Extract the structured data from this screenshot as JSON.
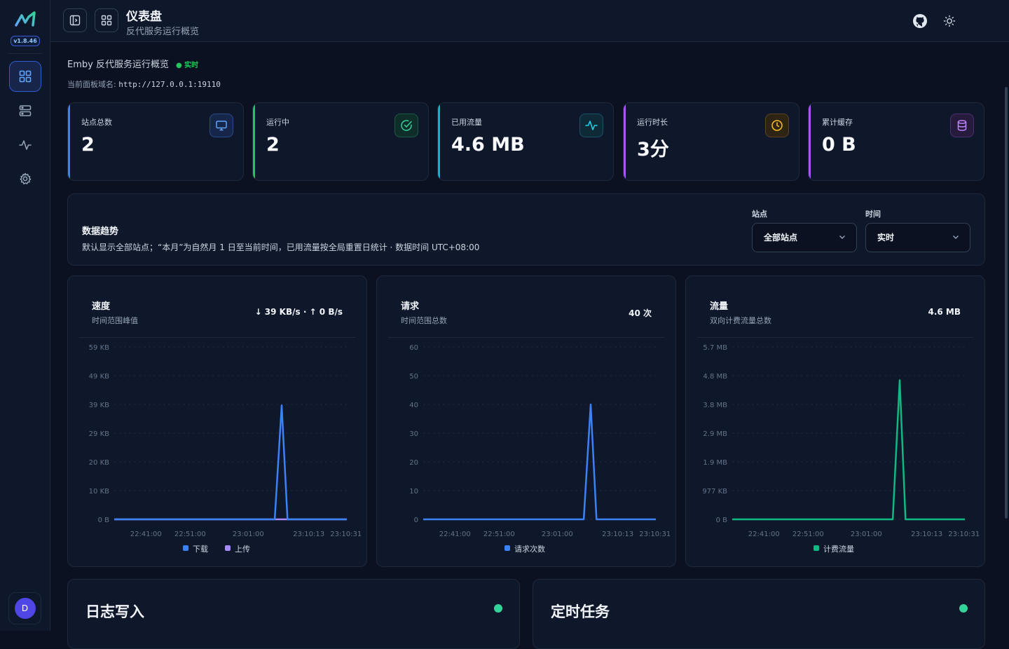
{
  "app": {
    "version": "v1.8.46",
    "user_initial": "D"
  },
  "header": {
    "title": "仪表盘",
    "subtitle": "反代服务运行概览"
  },
  "overview": {
    "text": "Emby 反代服务运行概览",
    "live": "● 实时",
    "domain_label": "当前面板域名:",
    "domain_value": "http://127.0.0.1:19110"
  },
  "stats": [
    {
      "label": "站点总数",
      "value": "2",
      "color": "#3b82f6",
      "icon": "monitor-icon"
    },
    {
      "label": "运行中",
      "value": "2",
      "color": "#22c55e",
      "icon": "check-circle-icon"
    },
    {
      "label": "已用流量",
      "value": "4.6 MB",
      "color": "#06b6d4",
      "icon": "activity-icon"
    },
    {
      "label": "运行时长",
      "value": "3分",
      "color": "#a855f7",
      "icon": "clock-icon"
    },
    {
      "label": "累计缓存",
      "value": "0 B",
      "color": "#a855f7",
      "icon": "database-icon"
    }
  ],
  "trend": {
    "title": "数据趋势",
    "desc": "默认显示全部站点；“本月”为自然月 1 日至当前时间，已用流量按全局重置日统计 · 数据时间 UTC+08:00",
    "site_label": "站点",
    "site_value": "全部站点",
    "time_label": "时间",
    "time_value": "实时"
  },
  "chart_data": [
    {
      "type": "line",
      "title": "速度",
      "subtitle": "时间范围峰值",
      "summary": "↓ 39 KB/s · ↑ 0 B/s",
      "yticks": [
        "59 KB",
        "49 KB",
        "39 KB",
        "29 KB",
        "20 KB",
        "10 KB",
        "0 B"
      ],
      "ylim": [
        0,
        59
      ],
      "xticks": [
        "22:41:00",
        "22:51:00",
        "23:01:00",
        "23:10:13",
        "23:10:31"
      ],
      "series": [
        {
          "name": "下载",
          "color": "#3b82f6",
          "points": [
            [
              0,
              0
            ],
            [
              0.69,
              0
            ],
            [
              0.72,
              39
            ],
            [
              0.745,
              0
            ],
            [
              1,
              0
            ]
          ]
        },
        {
          "name": "上传",
          "color": "#a78bfa",
          "points": [
            [
              0,
              0
            ],
            [
              1,
              0
            ]
          ]
        }
      ]
    },
    {
      "type": "line",
      "title": "请求",
      "subtitle": "时间范围总数",
      "summary": "40 次",
      "yticks": [
        "60",
        "50",
        "40",
        "30",
        "20",
        "10",
        "0"
      ],
      "ylim": [
        0,
        60
      ],
      "xticks": [
        "22:41:00",
        "22:51:00",
        "23:01:00",
        "23:10:13",
        "23:10:31"
      ],
      "series": [
        {
          "name": "请求次数",
          "color": "#3b82f6",
          "points": [
            [
              0,
              0
            ],
            [
              0.69,
              0
            ],
            [
              0.72,
              40
            ],
            [
              0.745,
              0
            ],
            [
              1,
              0
            ]
          ]
        }
      ]
    },
    {
      "type": "line",
      "title": "流量",
      "subtitle": "双向计费流量总数",
      "summary": "4.6 MB",
      "yticks": [
        "5.7 MB",
        "4.8 MB",
        "3.8 MB",
        "2.9 MB",
        "1.9 MB",
        "977 KB",
        "0 B"
      ],
      "ylim": [
        0,
        5.7
      ],
      "xticks": [
        "22:41:00",
        "22:51:00",
        "23:01:00",
        "23:10:13",
        "23:10:31"
      ],
      "series": [
        {
          "name": "计费流量",
          "color": "#10b981",
          "points": [
            [
              0,
              0
            ],
            [
              0.69,
              0
            ],
            [
              0.72,
              4.6
            ],
            [
              0.745,
              0
            ],
            [
              1,
              0
            ]
          ]
        }
      ]
    }
  ],
  "bottom": {
    "log_title": "日志写入",
    "task_title": "定时任务"
  }
}
